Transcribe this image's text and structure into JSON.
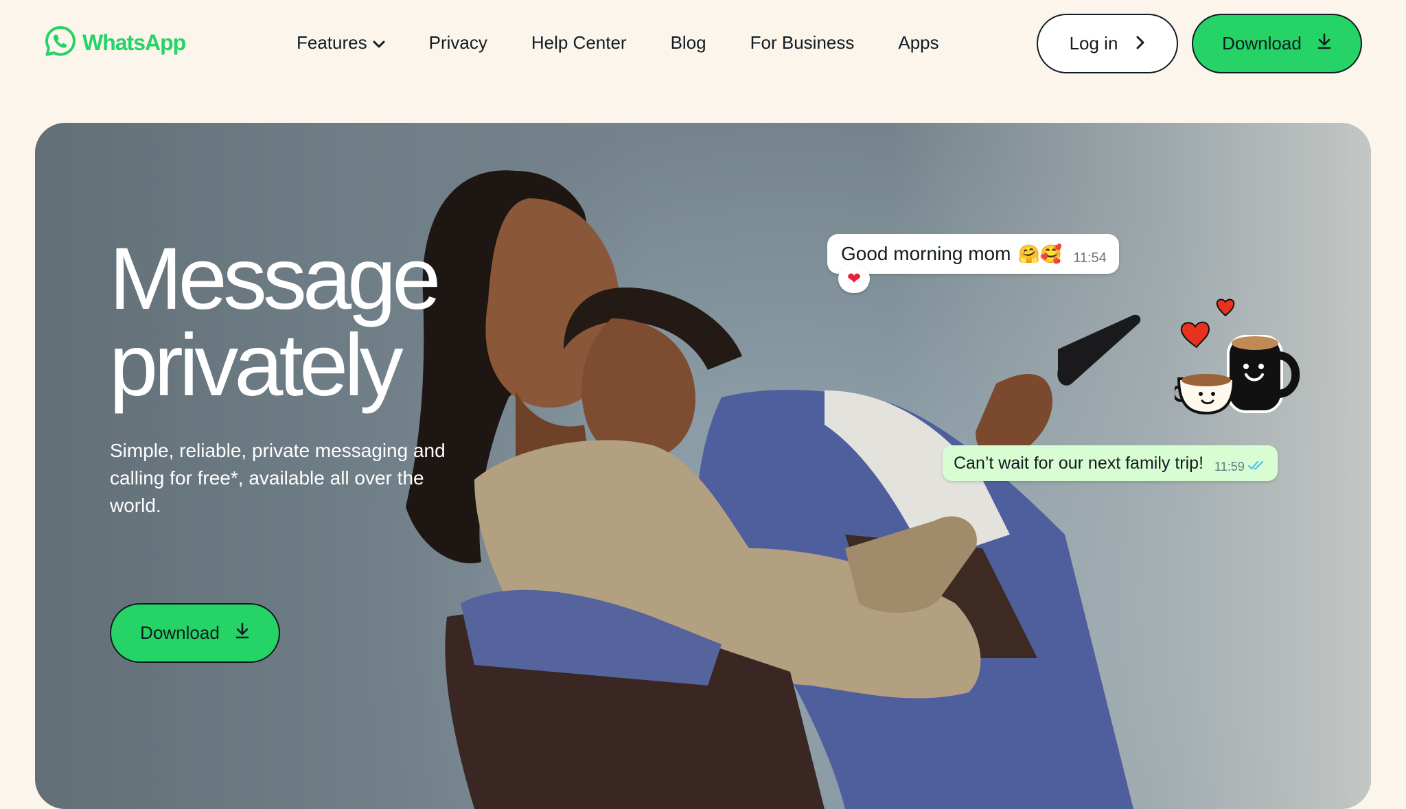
{
  "header": {
    "brand": "WhatsApp",
    "nav": [
      {
        "label": "Features",
        "has_dropdown": true
      },
      {
        "label": "Privacy"
      },
      {
        "label": "Help Center"
      },
      {
        "label": "Blog"
      },
      {
        "label": "For Business"
      },
      {
        "label": "Apps"
      }
    ],
    "login_label": "Log in",
    "download_label": "Download"
  },
  "hero": {
    "title_line1": "Message",
    "title_line2": "privately",
    "subtitle": "Simple, reliable, private messaging and calling for free*, available all over the world.",
    "download_label": "Download"
  },
  "chat": {
    "incoming": {
      "text": "Good morning mom",
      "emoji": "🤗🥰",
      "time": "11:54",
      "reaction": "❤"
    },
    "outgoing": {
      "text": "Can’t wait for our next family trip!",
      "time": "11:59",
      "status_icon": "double-check-icon"
    }
  },
  "colors": {
    "brand_green": "#25d366",
    "page_bg": "#fcf5eb",
    "text_dark": "#111b21",
    "bubble_out": "#d9fdd3",
    "read_receipt": "#53bdeb"
  },
  "icons": {
    "logo": "whatsapp-logo-icon",
    "dropdown": "chevron-down-icon",
    "login_arrow": "chevron-right-icon",
    "download": "download-arrow-icon"
  }
}
